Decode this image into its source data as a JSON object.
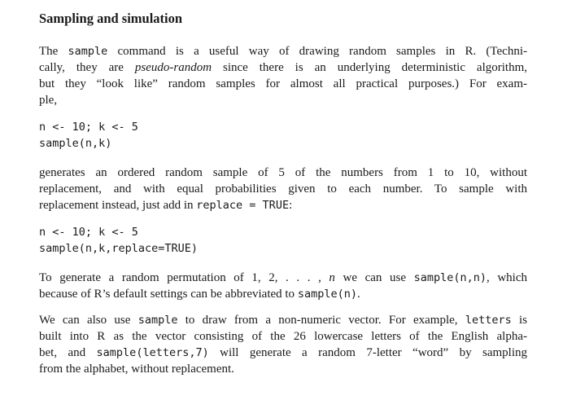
{
  "section": {
    "title": "Sampling and simulation"
  },
  "para1": {
    "l1_a": "The ",
    "l1_code": "sample",
    "l1_b": " command is a useful way of drawing random samples in R. (Techni-",
    "l2_a": "cally, they are ",
    "l2_em": "pseudo-random",
    "l2_b": " since there is an underlying deterministic algorithm,",
    "l3": "but they “look like” random samples for almost all practical purposes.) For exam-",
    "l4": "ple,"
  },
  "code1": {
    "line1": "n <- 10; k <- 5",
    "line2": "sample(n,k)"
  },
  "para2": {
    "l1": "generates an ordered random sample of 5 of the numbers from 1 to 10, without",
    "l2": "replacement, and with equal probabilities given to each number. To sample with",
    "l3_a": "replacement instead, just add in ",
    "l3_code": "replace = TRUE",
    "l3_b": ":"
  },
  "code2": {
    "line1": "n <- 10; k <- 5",
    "line2": "sample(n,k,replace=TRUE)"
  },
  "para3": {
    "l1_a": "To generate a random permutation of 1, 2, . . . , ",
    "l1_em": "n",
    "l1_b": " we can use ",
    "l1_code": "sample(n,n)",
    "l1_c": ", which",
    "l2_a": "because of R’s default settings can be abbreviated to ",
    "l2_code": "sample(n)",
    "l2_b": "."
  },
  "para4": {
    "l1_a": "We can also use ",
    "l1_code1": "sample",
    "l1_b": " to draw from a non-numeric vector. For example, ",
    "l1_code2": "letters",
    "l1_c": " is",
    "l2": "built into R as the vector consisting of the 26 lowercase letters of the English alpha-",
    "l3_a": "bet, and ",
    "l3_code": "sample(letters,7)",
    "l3_b": " will generate a random 7-letter “word” by sampling",
    "l4": "from the alphabet, without replacement."
  }
}
